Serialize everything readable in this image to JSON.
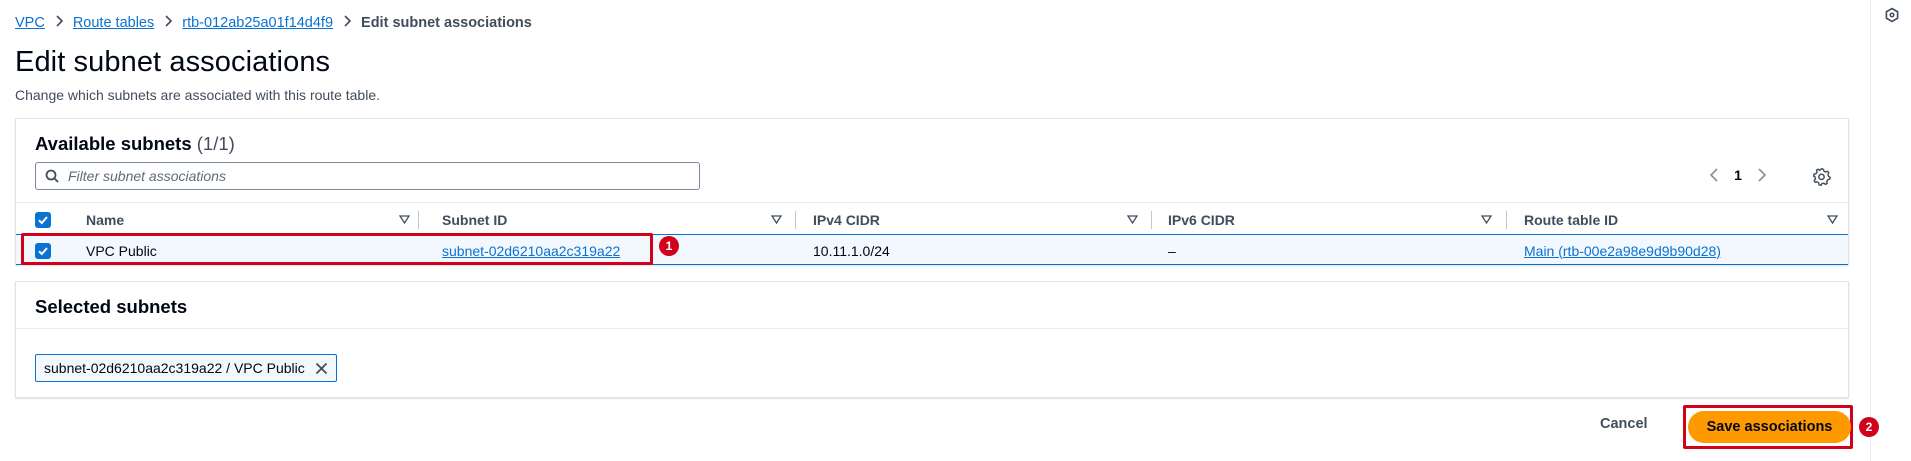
{
  "breadcrumb": {
    "items": [
      "VPC",
      "Route tables",
      "rtb-012ab25a01f14d4f9"
    ],
    "current": "Edit subnet associations"
  },
  "page": {
    "title": "Edit subnet associations",
    "description": "Change which subnets are associated with this route table."
  },
  "available": {
    "heading": "Available subnets",
    "count": "(1/1)",
    "filter_placeholder": "Filter subnet associations",
    "page_number": "1",
    "columns": [
      "Name",
      "Subnet ID",
      "IPv4 CIDR",
      "IPv6 CIDR",
      "Route table ID"
    ],
    "rows": [
      {
        "name": "VPC Public",
        "subnet_id": "subnet-02d6210aa2c319a22",
        "ipv4": "10.11.1.0/24",
        "ipv6": "–",
        "route_table": "Main (rtb-00e2a98e9d9b90d28)"
      }
    ]
  },
  "selected": {
    "heading": "Selected subnets",
    "tokens": [
      "subnet-02d6210aa2c319a22 / VPC Public"
    ]
  },
  "actions": {
    "cancel": "Cancel",
    "save": "Save associations"
  },
  "annotations": {
    "callout_1": "1",
    "callout_2": "2"
  },
  "colors": {
    "primary": "#ff9900",
    "link": "#0972d3",
    "highlight": "#d0021b"
  }
}
